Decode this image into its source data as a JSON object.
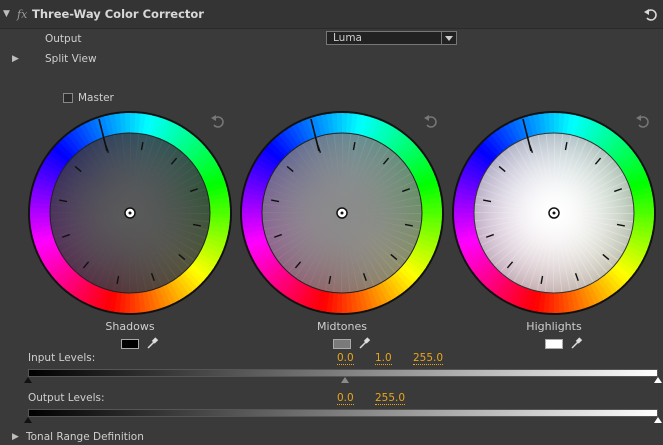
{
  "effect": {
    "fx_label": "fx",
    "title": "Three-Way Color Corrector"
  },
  "output": {
    "label": "Output",
    "value": "Luma"
  },
  "split_view": {
    "label": "Split View"
  },
  "master": {
    "label": "Master",
    "checked": false
  },
  "wheels": [
    {
      "label": "Shadows",
      "swatch_color": "#000000"
    },
    {
      "label": "Midtones",
      "swatch_color": "#7a7a7a"
    },
    {
      "label": "Highlights",
      "swatch_color": "#ffffff"
    }
  ],
  "input_levels": {
    "label": "Input Levels:",
    "black": "0.0",
    "gamma": "1.0",
    "white": "255.0"
  },
  "output_levels": {
    "label": "Output Levels:",
    "black": "0.0",
    "white": "255.0"
  },
  "tonal_range": {
    "label": "Tonal Range Definition"
  }
}
